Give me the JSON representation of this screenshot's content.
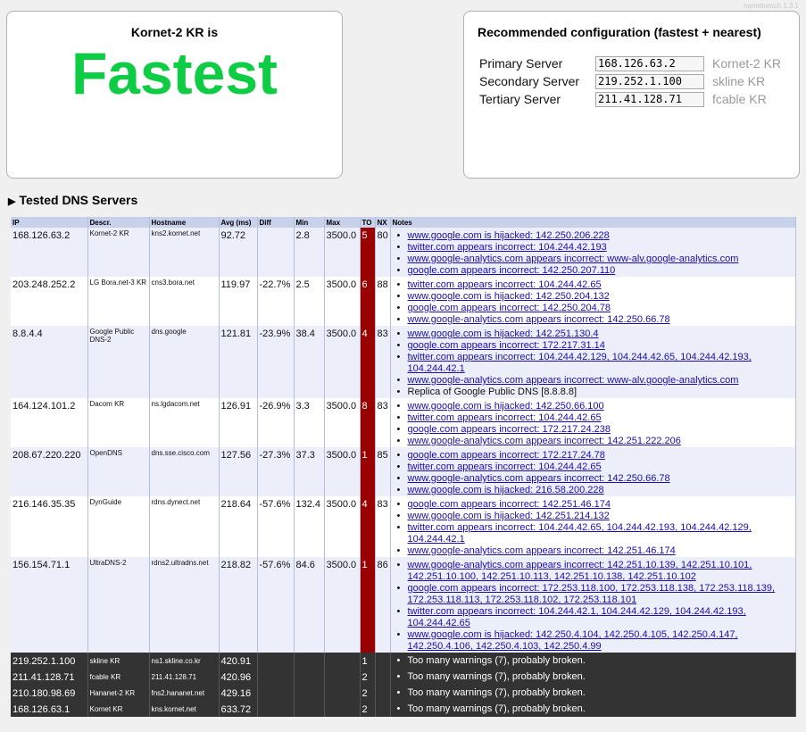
{
  "version": "namebench 1.3.1",
  "summary": {
    "headline": "Kornet-2 KR is",
    "verdict": "Fastest"
  },
  "recommended": {
    "title": "Recommended configuration (fastest + nearest)",
    "rows": [
      {
        "label": "Primary Server",
        "ip": "168.126.63.2",
        "name": "Kornet-2 KR"
      },
      {
        "label": "Secondary Server",
        "ip": "219.252.1.100",
        "name": "skline KR"
      },
      {
        "label": "Tertiary Server",
        "ip": "211.41.128.71",
        "name": "fcable KR"
      }
    ]
  },
  "tested": {
    "title": "Tested DNS Servers",
    "columns": [
      "IP",
      "Descr.",
      "Hostname",
      "Avg (ms)",
      "Diff",
      "Min",
      "Max",
      "TO",
      "NX",
      "Notes"
    ],
    "rows": [
      {
        "ip": "168.126.63.2",
        "descr": "Kornet-2 KR",
        "host": "kns2.kornet.net",
        "avg": "92.72",
        "diff": "",
        "min": "2.8",
        "max": "3500.0",
        "to": "5",
        "nx": "80",
        "notes": [
          {
            "text": "www.google.com is hijacked: 142.250.206.228",
            "link": true
          },
          {
            "text": "twitter.com appears incorrect: 104.244.42.193",
            "link": true
          },
          {
            "text": "www.google-analytics.com appears incorrect: www-alv.google-analytics.com",
            "link": true
          },
          {
            "text": "google.com appears incorrect: 142.250.207.110",
            "link": true
          }
        ]
      },
      {
        "ip": "203.248.252.2",
        "descr": "LG Bora.net-3 KR",
        "host": "cns3.bora.net",
        "avg": "119.97",
        "diff": "-22.7%",
        "min": "2.5",
        "max": "3500.0",
        "to": "6",
        "nx": "88",
        "notes": [
          {
            "text": "twitter.com appears incorrect: 104.244.42.65",
            "link": true
          },
          {
            "text": "www.google.com is hijacked: 142.250.204.132",
            "link": true
          },
          {
            "text": "google.com appears incorrect: 142.250.204.78",
            "link": true
          },
          {
            "text": "www.google-analytics.com appears incorrect: 142.250.66.78",
            "link": true
          }
        ]
      },
      {
        "ip": "8.8.4.4",
        "descr": "Google Public DNS-2",
        "host": "dns.google",
        "avg": "121.81",
        "diff": "-23.9%",
        "min": "38.4",
        "max": "3500.0",
        "to": "4",
        "nx": "83",
        "notes": [
          {
            "text": "www.google.com is hijacked: 142.251.130.4",
            "link": true
          },
          {
            "text": "google.com appears incorrect: 172.217.31.14",
            "link": true
          },
          {
            "text": "twitter.com appears incorrect: 104.244.42.129, 104.244.42.65, 104.244.42.193, 104.244.42.1",
            "link": true
          },
          {
            "text": "www.google-analytics.com appears incorrect: www-alv.google-analytics.com",
            "link": true
          },
          {
            "text": "Replica of Google Public DNS [8.8.8.8]",
            "link": false
          }
        ]
      },
      {
        "ip": "164.124.101.2",
        "descr": "Dacom KR",
        "host": "ns.lgdacom.net",
        "avg": "126.91",
        "diff": "-26.9%",
        "min": "3.3",
        "max": "3500.0",
        "to": "8",
        "nx": "83",
        "notes": [
          {
            "text": "www.google.com is hijacked: 142.250.66.100",
            "link": true
          },
          {
            "text": "twitter.com appears incorrect: 104.244.42.65",
            "link": true
          },
          {
            "text": "google.com appears incorrect: 172.217.24.238",
            "link": true
          },
          {
            "text": "www.google-analytics.com appears incorrect: 142.251.222.206",
            "link": true
          }
        ]
      },
      {
        "ip": "208.67.220.220",
        "descr": "OpenDNS",
        "host": "dns.sse.cisco.com",
        "avg": "127.56",
        "diff": "-27.3%",
        "min": "37.3",
        "max": "3500.0",
        "to": "1",
        "nx": "85",
        "notes": [
          {
            "text": "google.com appears incorrect: 172.217.24.78",
            "link": true
          },
          {
            "text": "twitter.com appears incorrect: 104.244.42.65",
            "link": true
          },
          {
            "text": "www.google-analytics.com appears incorrect: 142.250.66.78",
            "link": true
          },
          {
            "text": "www.google.com is hijacked: 216.58.200.228",
            "link": true
          }
        ]
      },
      {
        "ip": "216.146.35.35",
        "descr": "DynGuide",
        "host": "rdns.dynect.net",
        "avg": "218.64",
        "diff": "-57.6%",
        "min": "132.4",
        "max": "3500.0",
        "to": "4",
        "nx": "83",
        "notes": [
          {
            "text": "google.com appears incorrect: 142.251.46.174",
            "link": true
          },
          {
            "text": "www.google.com is hijacked: 142.251.214.132",
            "link": true
          },
          {
            "text": "twitter.com appears incorrect: 104.244.42.65, 104.244.42.193, 104.244.42.129, 104.244.42.1",
            "link": true
          },
          {
            "text": "www.google-analytics.com appears incorrect: 142.251.46.174",
            "link": true
          }
        ]
      },
      {
        "ip": "156.154.71.1",
        "descr": "UltraDNS-2",
        "host": "rdns2.ultradns.net",
        "avg": "218.82",
        "diff": "-57.6%",
        "min": "84.6",
        "max": "3500.0",
        "to": "1",
        "nx": "86",
        "notes": [
          {
            "text": "www.google-analytics.com appears incorrect: 142.251.10.139, 142.251.10.101, 142.251.10.100, 142.251.10.113, 142.251.10.138, 142.251.10.102",
            "link": true
          },
          {
            "text": "google.com appears incorrect: 172.253.118.100, 172.253.118.138, 172.253.118.139, 172.253.118.113, 172.253.118.102, 172.253.118.101",
            "link": true
          },
          {
            "text": "twitter.com appears incorrect: 104.244.42.1, 104.244.42.129, 104.244.42.193, 104.244.42.65",
            "link": true
          },
          {
            "text": "www.google.com is hijacked: 142.250.4.104, 142.250.4.105, 142.250.4.147, 142.250.4.106, 142.250.4.103, 142.250.4.99",
            "link": true
          }
        ]
      }
    ],
    "broken": [
      {
        "ip": "219.252.1.100",
        "descr": "skline KR",
        "host": "ns1.skline.co.kr",
        "avg": "420.91",
        "to": "1",
        "note": "Too many warnings (7), probably broken."
      },
      {
        "ip": "211.41.128.71",
        "descr": "fcable KR",
        "host": "211.41.128.71",
        "avg": "420.96",
        "to": "2",
        "note": "Too many warnings (7), probably broken."
      },
      {
        "ip": "210.180.98.69",
        "descr": "Hananet-2 KR",
        "host": "fns2.hananet.net",
        "avg": "429.16",
        "to": "2",
        "note": "Too many warnings (7), probably broken."
      },
      {
        "ip": "168.126.63.1",
        "descr": "Kornet KR",
        "host": "kns.kornet.net",
        "avg": "633.72",
        "to": "2",
        "note": "Too many warnings (7), probably broken."
      }
    ]
  }
}
